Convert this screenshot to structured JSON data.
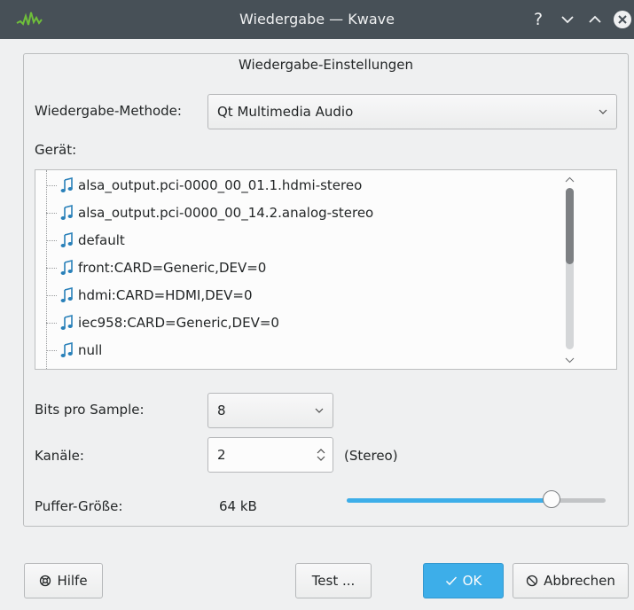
{
  "window": {
    "title": "Wiedergabe — Kwave",
    "help_glyph": "?"
  },
  "group": {
    "title": "Wiedergabe-Einstellungen"
  },
  "method": {
    "label": "Wiedergabe-Methode:",
    "value": "Qt Multimedia Audio"
  },
  "device": {
    "label": "Gerät:",
    "items": [
      "alsa_output.pci-0000_00_01.1.hdmi-stereo",
      "alsa_output.pci-0000_00_14.2.analog-stereo",
      "default",
      "front:CARD=Generic,DEV=0",
      "hdmi:CARD=HDMI,DEV=0",
      "iec958:CARD=Generic,DEV=0",
      "null"
    ]
  },
  "bits": {
    "label": "Bits pro Sample:",
    "value": "8"
  },
  "channels": {
    "label": "Kanäle:",
    "value": "2",
    "description": "(Stereo)"
  },
  "buffer": {
    "label": "Puffer-Größe:",
    "value": "64 kB",
    "slider_fraction": 0.79
  },
  "buttons": {
    "help": "Hilfe",
    "test": "Test ...",
    "ok": "OK",
    "cancel": "Abbrechen"
  },
  "colors": {
    "titlebar": "#475057",
    "accent": "#3daee9",
    "icon_blue": "#2980b9"
  }
}
